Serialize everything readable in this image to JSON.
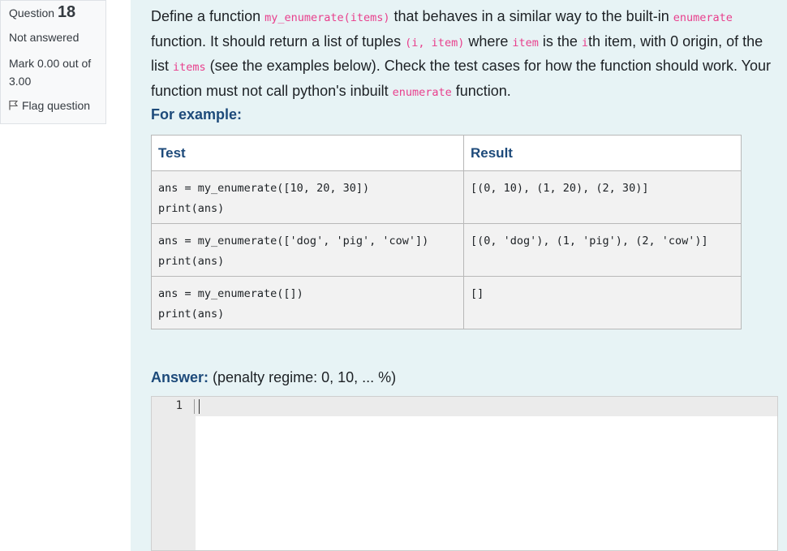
{
  "info": {
    "question_word": "Question",
    "question_number": "18",
    "state": "Not answered",
    "grade": "Mark 0.00 out of 3.00",
    "flag_label": "Flag question"
  },
  "question": {
    "t1": "Define a function ",
    "c1": "my_enumerate(items)",
    "t2": " that behaves in a similar way to the built-in ",
    "c2": "enumerate",
    "t3": " function. It should return a list of tuples ",
    "c3": "(i, item)",
    "t4": " where ",
    "c4": "item",
    "t5": " is the ",
    "c5": "i",
    "t6": "th item, with 0 origin, of the list ",
    "c6": "items",
    "t7": " (see the examples below). Check the test cases for how the function should work. Your function must not call python's inbuilt ",
    "c7": "enumerate",
    "t8": " function."
  },
  "for_example": "For example:",
  "table": {
    "headers": [
      "Test",
      "Result"
    ],
    "rows": [
      {
        "test": "ans = my_enumerate([10, 20, 30])\nprint(ans)",
        "result": "[(0, 10), (1, 20), (2, 30)]"
      },
      {
        "test": "ans = my_enumerate(['dog', 'pig', 'cow'])\nprint(ans)",
        "result": "[(0, 'dog'), (1, 'pig'), (2, 'cow')]"
      },
      {
        "test": "ans = my_enumerate([])\nprint(ans)",
        "result": "[]"
      }
    ]
  },
  "answer": {
    "label": "Answer:",
    "penalty": "(penalty regime: 0, 10, ... %)",
    "line_number": "1",
    "value": ""
  },
  "icons": {
    "flag": "flag-icon"
  },
  "colors": {
    "accent": "#1d4a7a",
    "code": "#e83e8c",
    "content_bg": "#e7f3f5"
  }
}
